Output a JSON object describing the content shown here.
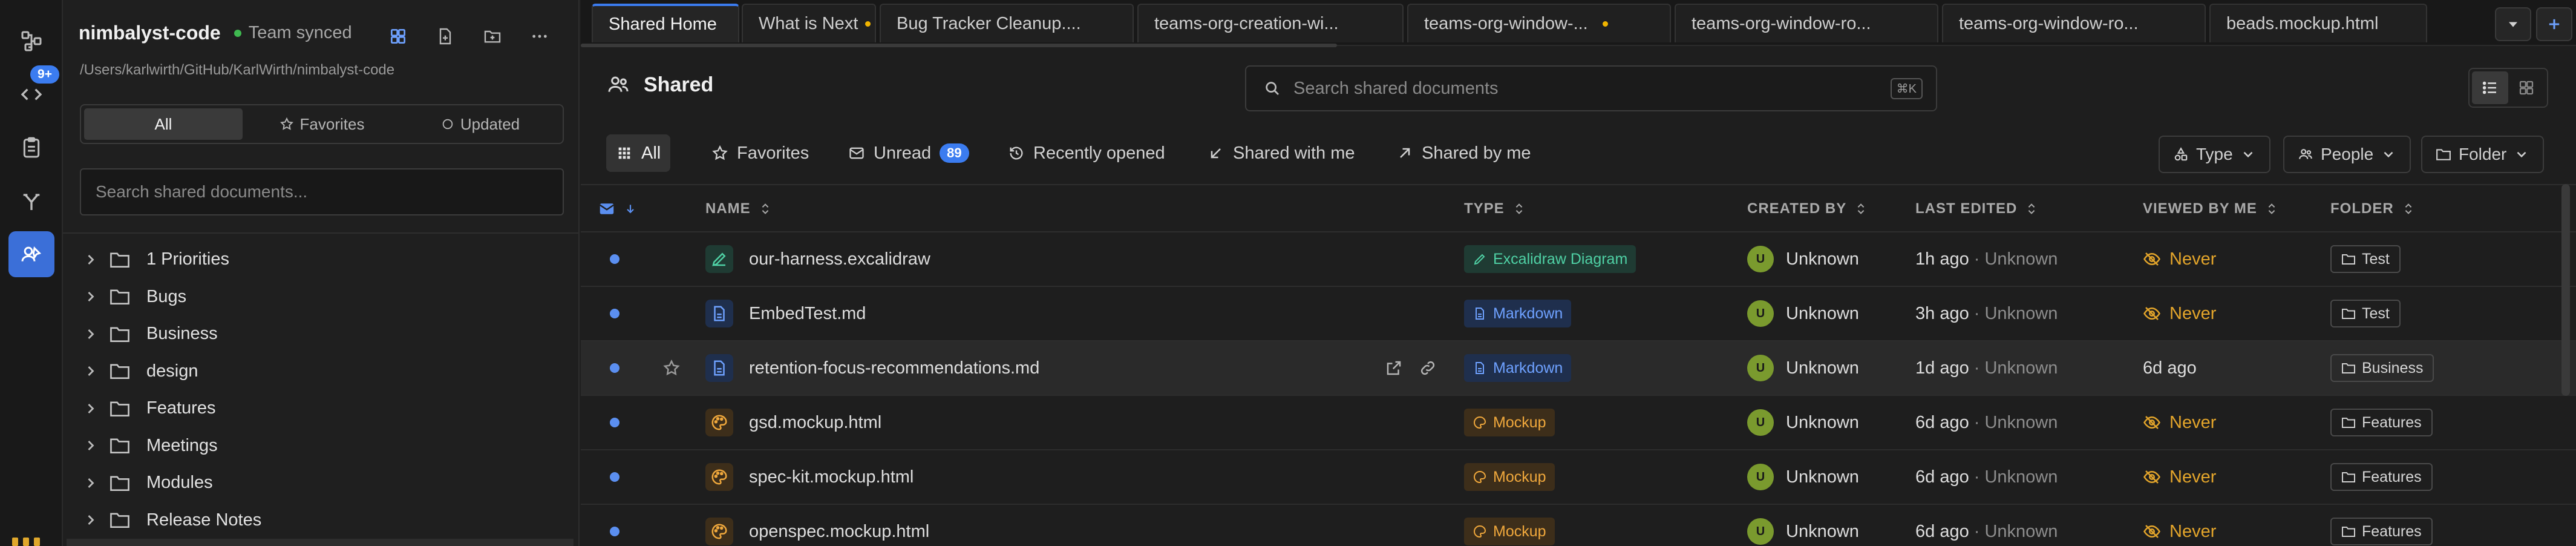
{
  "activity": {
    "badge": "9+"
  },
  "sidebar": {
    "title": "nimbalyst-code",
    "sync_status": "Team synced",
    "path": "/Users/karlwirth/GitHub/KarlWirth/nimbalyst-code",
    "segments": [
      {
        "label": "All",
        "icon": ""
      },
      {
        "label": "Favorites",
        "icon": "star-icon"
      },
      {
        "label": "Updated",
        "icon": "circle-icon"
      }
    ],
    "search_placeholder": "Search shared documents...",
    "tree": [
      {
        "label": "1 Priorities"
      },
      {
        "label": "Bugs"
      },
      {
        "label": "Business"
      },
      {
        "label": "design"
      },
      {
        "label": "Features"
      },
      {
        "label": "Meetings"
      },
      {
        "label": "Modules"
      },
      {
        "label": "Release Notes"
      }
    ]
  },
  "tabs": [
    {
      "label": "Shared Home",
      "modified": false
    },
    {
      "label": "What is Next",
      "modified": true
    },
    {
      "label": "Bug Tracker Cleanup....",
      "modified": false
    },
    {
      "label": "teams-org-creation-wi...",
      "modified": false
    },
    {
      "label": "teams-org-window-...",
      "modified": true
    },
    {
      "label": "teams-org-window-ro...",
      "modified": false
    },
    {
      "label": "teams-org-window-ro...",
      "modified": false
    },
    {
      "label": "beads.mockup.html",
      "modified": false
    }
  ],
  "header": {
    "title": "Shared",
    "search_placeholder": "Search shared documents",
    "shortcut": "⌘K"
  },
  "filters": {
    "chips": [
      {
        "label": "All",
        "icon": "grid-icon"
      },
      {
        "label": "Favorites",
        "icon": "star-icon"
      },
      {
        "label": "Unread",
        "icon": "mail-icon",
        "count": "89"
      },
      {
        "label": "Recently opened",
        "icon": "history-icon"
      },
      {
        "label": "Shared with me",
        "icon": "arrow-down-left-icon"
      },
      {
        "label": "Shared by me",
        "icon": "arrow-up-right-icon"
      }
    ],
    "dropdowns": [
      {
        "label": "Type",
        "icon": "shapes-icon"
      },
      {
        "label": "People",
        "icon": "people-icon"
      },
      {
        "label": "Folder",
        "icon": "folder-icon"
      }
    ]
  },
  "table": {
    "columns": {
      "name": "NAME",
      "type": "TYPE",
      "created_by": "CREATED BY",
      "last_edited": "LAST EDITED",
      "viewed_by_me": "VIEWED BY ME",
      "folder": "FOLDER"
    },
    "rows": [
      {
        "name": "our-harness.excalidraw",
        "kind": "excalidraw",
        "type": "Excalidraw Diagram",
        "creator_initial": "U",
        "creator": "Unknown",
        "edited": "1h ago",
        "editor": "· Unknown",
        "viewed": "Never",
        "folder": "Test"
      },
      {
        "name": "EmbedTest.md",
        "kind": "markdown",
        "type": "Markdown",
        "creator_initial": "U",
        "creator": "Unknown",
        "edited": "3h ago",
        "editor": "· Unknown",
        "viewed": "Never",
        "folder": "Test"
      },
      {
        "name": "retention-focus-recommendations.md",
        "kind": "markdown",
        "type": "Markdown",
        "creator_initial": "U",
        "creator": "Unknown",
        "edited": "1d ago",
        "editor": "· Unknown",
        "viewed": "6d ago",
        "folder": "Business"
      },
      {
        "name": "gsd.mockup.html",
        "kind": "mockup",
        "type": "Mockup",
        "creator_initial": "U",
        "creator": "Unknown",
        "edited": "6d ago",
        "editor": "· Unknown",
        "viewed": "Never",
        "folder": "Features"
      },
      {
        "name": "spec-kit.mockup.html",
        "kind": "mockup",
        "type": "Mockup",
        "creator_initial": "U",
        "creator": "Unknown",
        "edited": "6d ago",
        "editor": "· Unknown",
        "viewed": "Never",
        "folder": "Features"
      },
      {
        "name": "openspec.mockup.html",
        "kind": "mockup",
        "type": "Mockup",
        "creator_initial": "U",
        "creator": "Unknown",
        "edited": "6d ago",
        "editor": "· Unknown",
        "viewed": "Never",
        "folder": "Features"
      }
    ]
  },
  "colors": {
    "accent": "#3b7cf0",
    "excalidraw_bg": "#1f3b33",
    "excalidraw_fg": "#4fd1a5",
    "markdown_bg": "#1f2f4d",
    "markdown_fg": "#6ea1ff",
    "mockup_bg": "#3d2e1a",
    "mockup_fg": "#f0a83c",
    "never": "#e3a52b"
  }
}
